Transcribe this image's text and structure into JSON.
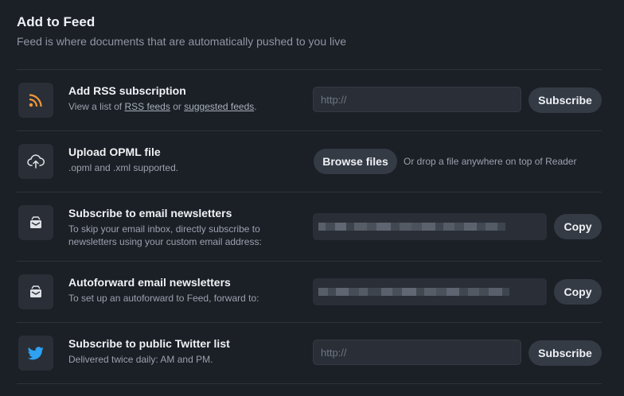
{
  "header": {
    "title": "Add to Feed",
    "subtitle": "Feed is where documents that are automatically pushed to you live"
  },
  "rows": {
    "rss": {
      "icon": "rss-icon",
      "title": "Add RSS subscription",
      "desc_prefix": "View a list of ",
      "link1": "RSS feeds",
      "desc_mid": " or ",
      "link2": "suggested feeds",
      "desc_suffix": ".",
      "input_placeholder": "http://",
      "button": "Subscribe"
    },
    "opml": {
      "icon": "cloud-upload-icon",
      "title": "Upload OPML file",
      "desc": ".opml and .xml supported.",
      "button": "Browse files",
      "note": "Or drop a file anywhere on top of Reader"
    },
    "newsletters": {
      "icon": "inbox-icon",
      "title": "Subscribe to email newsletters",
      "desc_line1": "To skip your email inbox, directly subscribe to",
      "desc_line2": "newsletters using your custom email address:",
      "button": "Copy"
    },
    "autoforward": {
      "icon": "inbox-icon",
      "title": "Autoforward email newsletters",
      "desc": "To set up an autoforward to Feed, forward to:",
      "button": "Copy"
    },
    "twitter": {
      "icon": "twitter-bird-icon",
      "title": "Subscribe to public Twitter list",
      "desc": "Delivered twice daily: AM and PM.",
      "input_placeholder": "http://",
      "button": "Subscribe"
    }
  },
  "colors": {
    "background": "#1b1f26",
    "rss_orange": "#f2993a",
    "twitter_blue": "#2ea1f2"
  }
}
